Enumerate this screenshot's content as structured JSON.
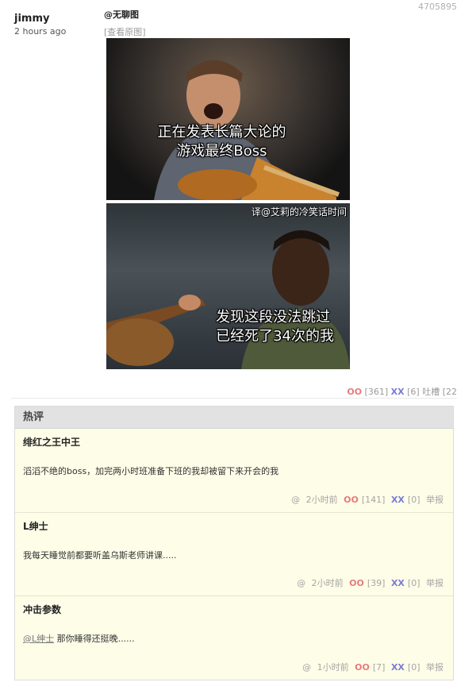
{
  "post": {
    "id": "4705895",
    "author": "jimmy",
    "time": "2 hours ago",
    "title": "@无聊图",
    "original_link": "[查看原图]",
    "image1_caption_line1": "正在发表长篇大论的",
    "image1_caption_line2": "游戏最终Boss",
    "image2_watermark": "译@艾莉的冷笑话时间",
    "image2_caption_line1": "发现这段没法跳过",
    "image2_caption_line2": "已经死了34次的我",
    "oo_label": "OO",
    "oo_count": "[361]",
    "xx_label": "XX",
    "xx_count": "[6]",
    "tucao": "吐槽 [22"
  },
  "hot_comments": {
    "header": "热评",
    "items": [
      {
        "author": "绯红之王中王",
        "text": "滔滔不绝的boss，加完两小时班准备下班的我却被留下来开会的我",
        "at": "@",
        "time": "2小时前",
        "oo_label": "OO",
        "oo": "[141]",
        "xx_label": "XX",
        "xx": "[0]",
        "report": "举报"
      },
      {
        "author": "L绅士",
        "text": "我每天睡觉前都要听盖乌斯老师讲课.....",
        "at": "@",
        "time": "2小时前",
        "oo_label": "OO",
        "oo": "[39]",
        "xx_label": "XX",
        "xx": "[0]",
        "report": "举报"
      },
      {
        "author": "冲击参数",
        "mention": "@L绅士",
        "text": " 那你睡得还挺晚......",
        "at": "@",
        "time": "1小时前",
        "oo_label": "OO",
        "oo": "[7]",
        "xx_label": "XX",
        "xx": "[0]",
        "report": "举报"
      }
    ]
  }
}
